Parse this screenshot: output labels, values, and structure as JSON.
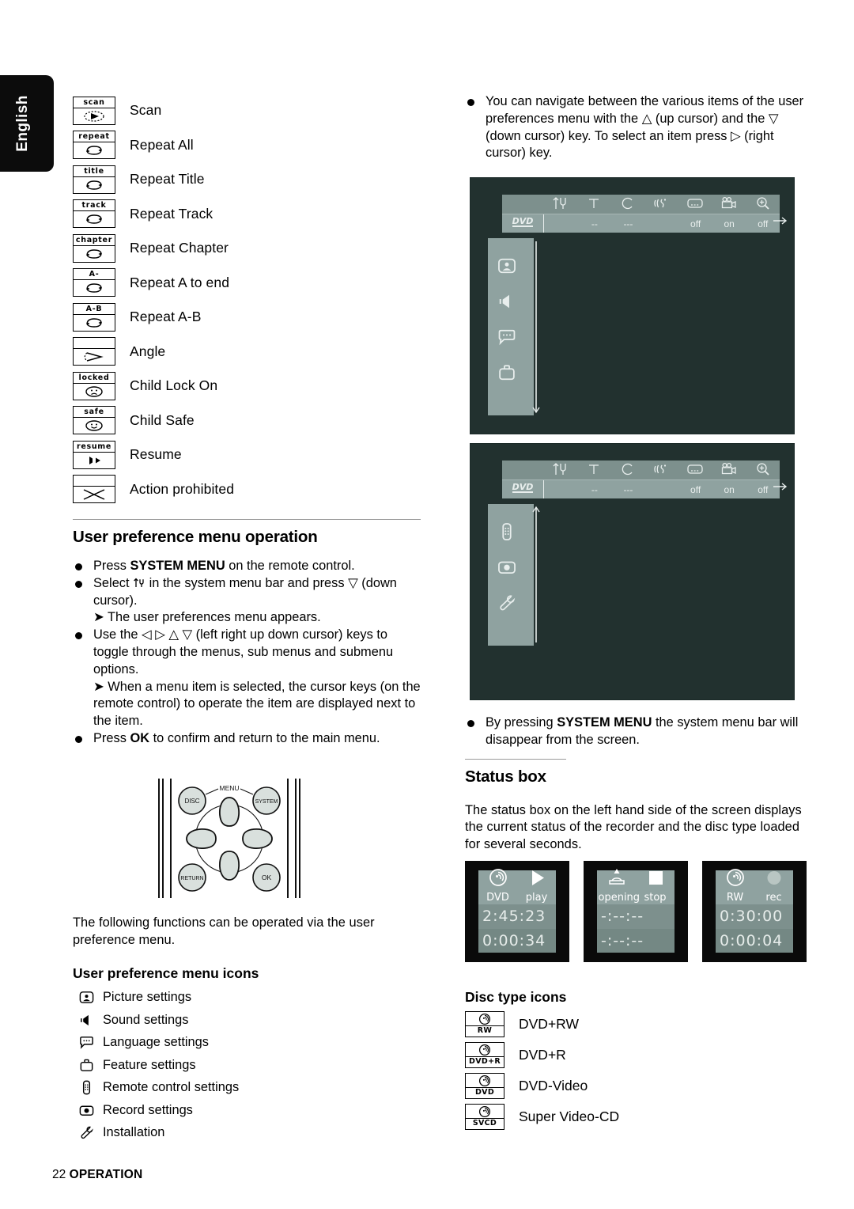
{
  "language_tab": {
    "label": "English"
  },
  "footer": {
    "page_number": "22",
    "section": "OPERATION"
  },
  "left_column": {
    "status_icons": [
      {
        "cap": "scan",
        "label": "Scan",
        "icon": "scan-icon"
      },
      {
        "cap": "repeat",
        "label": "Repeat All",
        "icon": "repeat-icon"
      },
      {
        "cap": "title",
        "label": "Repeat Title",
        "icon": "repeat-icon"
      },
      {
        "cap": "track",
        "label": "Repeat Track",
        "icon": "repeat-icon"
      },
      {
        "cap": "chapter",
        "label": "Repeat Chapter",
        "icon": "repeat-icon"
      },
      {
        "cap": "A-",
        "label": "Repeat A to end",
        "icon": "repeat-icon"
      },
      {
        "cap": "A-B",
        "label": "Repeat A-B",
        "icon": "repeat-icon"
      },
      {
        "cap": "",
        "label": "Angle",
        "icon": "angle-icon"
      },
      {
        "cap": "locked",
        "label": "Child Lock On",
        "icon": "sad-face-icon"
      },
      {
        "cap": "safe",
        "label": "Child Safe",
        "icon": "happy-face-icon"
      },
      {
        "cap": "resume",
        "label": "Resume",
        "icon": "resume-icon"
      },
      {
        "cap": "",
        "label": "Action prohibited",
        "icon": "cross-icon"
      }
    ],
    "section_title": "User preference menu operation",
    "bullets": [
      {
        "parts": [
          {
            "t": "Press ",
            "b": false
          },
          {
            "t": "SYSTEM MENU",
            "b": true
          },
          {
            "t": " on the remote control.",
            "b": false
          }
        ]
      },
      {
        "parts": [
          {
            "t": "Select ",
            "b": false
          },
          {
            "t": "⇅",
            "b": false
          },
          {
            "t": " in the system menu bar and press ▽ (down cursor).",
            "b": false
          }
        ]
      },
      {
        "parts": [
          {
            "t": "Use the ◁ ▷ △ ▽ (left right up down cursor) keys to toggle through the menus, sub menus and submenu options.",
            "b": false
          }
        ]
      },
      {
        "parts": [
          {
            "t": "Press ",
            "b": false
          },
          {
            "t": "OK",
            "b": true
          },
          {
            "t": " to confirm and return to the main menu.",
            "b": false
          }
        ]
      }
    ],
    "arrow_note_1": "The user preferences menu appears.",
    "arrow_note_2": "When a menu item is selected, the cursor keys (on the remote control) to operate the item are displayed next to the item.",
    "remote": {
      "disc_label": "DISC",
      "menu_label": "MENU",
      "system_label": "SYSTEM",
      "return_label": "RETURN",
      "ok_label": "OK"
    },
    "intro_text": "The following functions can be operated via the user preference menu.",
    "menu_icons_title": "User preference menu icons",
    "menu_icons": [
      {
        "label": "Picture settings",
        "icon": "picture-settings-icon"
      },
      {
        "label": "Sound settings",
        "icon": "sound-settings-icon"
      },
      {
        "label": "Language settings",
        "icon": "language-settings-icon"
      },
      {
        "label": "Feature settings",
        "icon": "feature-settings-icon"
      },
      {
        "label": "Remote control settings",
        "icon": "remote-settings-icon"
      },
      {
        "label": "Record settings",
        "icon": "record-settings-icon"
      },
      {
        "label": "Installation",
        "icon": "installation-wrench-icon"
      }
    ]
  },
  "right_column": {
    "nav_bullet": "You can navigate between the various items of the user preferences menu with the △ (up cursor) and the ▽ (down cursor) key. To select an item press ▷ (right cursor) key.",
    "system_menu_bar": {
      "disc_logo": "DVD",
      "icons": [
        "preferences-icon",
        "title-icon",
        "chapter-icon",
        "sound-icon",
        "subtitle-icon",
        "camera-angle-icon",
        "zoom-icon"
      ],
      "values": [
        "",
        "--",
        "---",
        "",
        "off",
        "on",
        "off"
      ]
    },
    "screen1_sidebar": {
      "icons": [
        "picture-settings-icon",
        "sound-settings-icon",
        "language-settings-icon",
        "feature-settings-icon"
      ],
      "scroll_arrow": "down"
    },
    "screen2_sidebar": {
      "icons": [
        "remote-settings-icon",
        "record-settings-icon",
        "installation-wrench-icon"
      ],
      "scroll_arrow": "up"
    },
    "disappear_bullet": {
      "pre": "By pressing ",
      "bold": "SYSTEM MENU",
      "post": " the system menu bar will disappear from the screen."
    },
    "status_box_title": "Status box",
    "status_box_text": "The status box on the left hand side of the screen displays the current status of the recorder and the disc type loaded for several seconds.",
    "status_boxes": [
      {
        "left_icon": "disc-icon",
        "left_label": "DVD",
        "right_icon": "play-icon",
        "right_label": "play",
        "time1": "2:45:23",
        "time2": "0:00:34"
      },
      {
        "left_icon": "tray-open-icon",
        "left_label": "opening",
        "right_icon": "stop-icon",
        "right_label": "stop",
        "time1": "-:--:--",
        "time2": "-:--:--"
      },
      {
        "left_icon": "disc-icon",
        "left_label": "RW",
        "right_icon": "record-icon",
        "right_label": "rec",
        "time1": "0:30:00",
        "time2": "0:00:04"
      }
    ],
    "disc_icons_title": "Disc type icons",
    "disc_icons": [
      {
        "tag": "RW",
        "label": "DVD+RW"
      },
      {
        "tag": "DVD+R",
        "label": "DVD+R"
      },
      {
        "tag": "DVD",
        "label": "DVD-Video"
      },
      {
        "tag": "SVCD",
        "label": "Super Video-CD"
      }
    ]
  },
  "colors": {
    "screen_bg": "#22312f",
    "panel": "#8fa2a0",
    "panel_dark": "#7d908d",
    "text_light": "#e8eeed",
    "tab_bg": "#0c0c0c"
  }
}
